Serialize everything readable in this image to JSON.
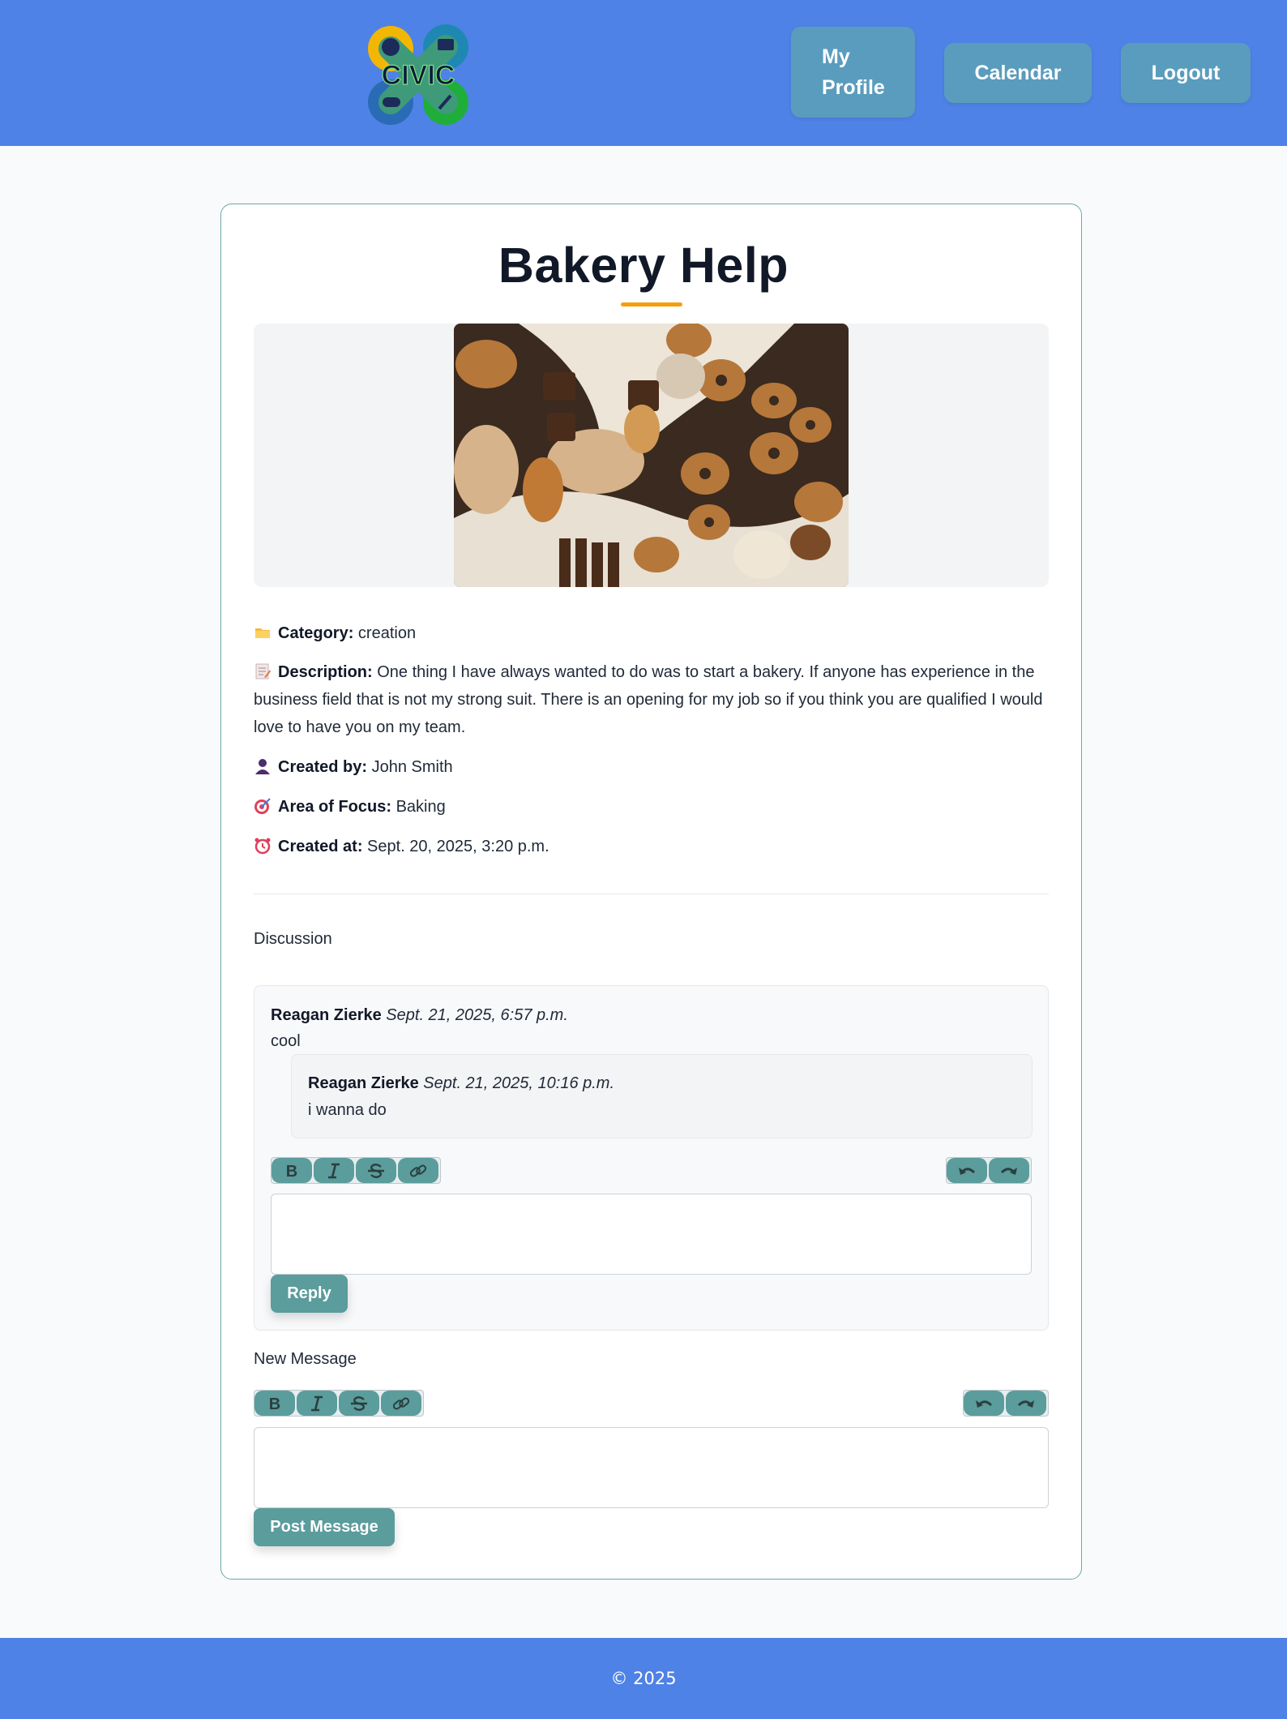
{
  "header": {
    "logo_text": "CIVIC",
    "nav": {
      "profile_line1": "My",
      "profile_line2": "Profile",
      "calendar": "Calendar",
      "logout": "Logout"
    }
  },
  "post": {
    "title": "Bakery Help",
    "category_label": "Category:",
    "category": "creation",
    "description_label": "Description:",
    "description": "One thing I have always wanted to do was to start a bakery. If anyone has experience in the business field that is not my strong suit. There is an opening for my job so if you think you are qualified I would love to have you on my team.",
    "created_by_label": "Created by:",
    "created_by": "John Smith",
    "focus_label": "Area of Focus:",
    "focus": "Baking",
    "created_at_label": "Created at:",
    "created_at": "Sept. 20, 2025, 3:20 p.m."
  },
  "discussion": {
    "label": "Discussion",
    "comments": [
      {
        "author": "Reagan Zierke",
        "timestamp": "Sept. 21, 2025, 6:57 p.m.",
        "body": "cool",
        "replies": [
          {
            "author": "Reagan Zierke",
            "timestamp": "Sept. 21, 2025, 10:16 p.m.",
            "body": "i wanna do"
          }
        ]
      }
    ],
    "reply_button": "Reply"
  },
  "new_message": {
    "label": "New Message",
    "post_button": "Post Message"
  },
  "toolbar": {
    "bold": "bold-icon",
    "italic": "italic-icon",
    "strike": "strikethrough-icon",
    "link": "link-icon",
    "undo": "undo-icon",
    "redo": "redo-icon"
  },
  "footer": {
    "copyright": "© 2025"
  },
  "colors": {
    "header_bg": "#4f82e6",
    "nav_button": "#5a9cbd",
    "accent_teal": "#5b9c9c",
    "title_underline": "#f59e0b"
  }
}
